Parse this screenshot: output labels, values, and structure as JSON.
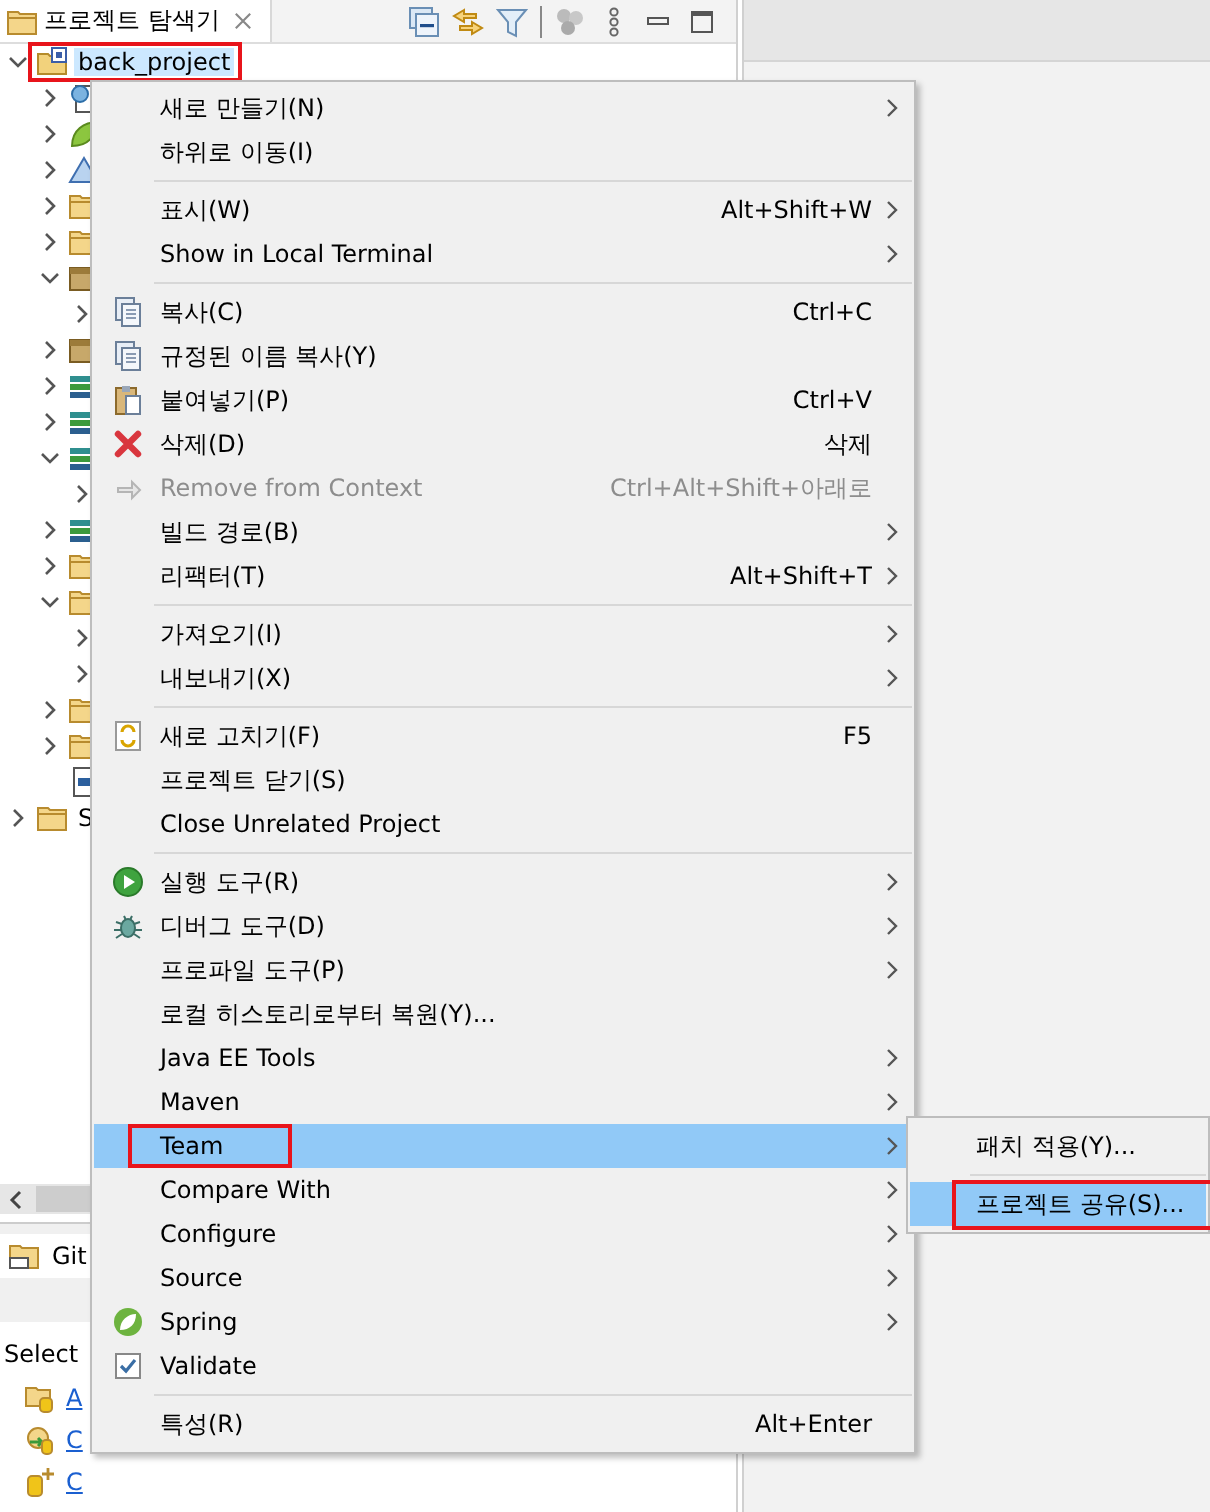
{
  "explorer": {
    "title": "프로젝트 탐색기",
    "tree": [
      {
        "label": "back_project",
        "kind": "project",
        "expanded": true,
        "selected": true,
        "annotated": true,
        "children": [
          {
            "kind": "doc",
            "expanded": false
          },
          {
            "kind": "spring",
            "expanded": false
          },
          {
            "kind": "deploy",
            "expanded": false
          },
          {
            "kind": "folder",
            "expanded": false
          },
          {
            "kind": "folder",
            "expanded": false
          },
          {
            "kind": "package",
            "expanded": true,
            "children": [
              {
                "expanded": false
              }
            ]
          },
          {
            "kind": "package",
            "expanded": false
          },
          {
            "kind": "library",
            "expanded": false
          },
          {
            "kind": "library",
            "expanded": false
          },
          {
            "kind": "library",
            "expanded": true,
            "children": [
              {
                "expanded": false
              }
            ]
          },
          {
            "kind": "library",
            "expanded": false
          },
          {
            "kind": "folder",
            "expanded": false
          },
          {
            "kind": "folder",
            "expanded": true,
            "children": [
              {
                "expanded": false
              },
              {
                "expanded": false
              }
            ]
          },
          {
            "kind": "folder",
            "expanded": false
          },
          {
            "kind": "folder",
            "expanded": false
          },
          {
            "kind": "file"
          }
        ]
      },
      {
        "label": "S",
        "kind": "folder",
        "expanded": false,
        "selected": false
      }
    ]
  },
  "git_panel": {
    "title": "Git",
    "hint": "Select",
    "links": [
      "A",
      "C",
      "C"
    ]
  },
  "context_menu": {
    "groups": [
      [
        {
          "label": "새로 만들기(N)",
          "submenu": true,
          "disabled": false,
          "selected": false
        },
        {
          "label": "하위로 이동(I)",
          "submenu": false,
          "disabled": false,
          "selected": false
        }
      ],
      [
        {
          "label": "표시(W)",
          "shortcut": "Alt+Shift+W",
          "submenu": true,
          "disabled": false,
          "selected": false
        },
        {
          "label": "Show in Local Terminal",
          "submenu": true,
          "disabled": false,
          "selected": false
        }
      ],
      [
        {
          "label": "복사(C)",
          "shortcut": "Ctrl+C",
          "submenu": false,
          "disabled": false,
          "selected": false
        },
        {
          "label": "규정된 이름 복사(Y)",
          "submenu": false,
          "disabled": false,
          "selected": false
        },
        {
          "label": "붙여넣기(P)",
          "shortcut": "Ctrl+V",
          "submenu": false,
          "disabled": false,
          "selected": false
        },
        {
          "label": "삭제(D)",
          "shortcut": "삭제",
          "submenu": false,
          "disabled": false,
          "selected": false
        },
        {
          "label": "Remove from Context",
          "shortcut": "Ctrl+Alt+Shift+아래로",
          "submenu": false,
          "disabled": true,
          "selected": false
        },
        {
          "label": "빌드 경로(B)",
          "submenu": true,
          "disabled": false,
          "selected": false
        },
        {
          "label": "리팩터(T)",
          "shortcut": "Alt+Shift+T",
          "submenu": true,
          "disabled": false,
          "selected": false
        }
      ],
      [
        {
          "label": "가져오기(I)",
          "submenu": true,
          "disabled": false,
          "selected": false
        },
        {
          "label": "내보내기(X)",
          "submenu": true,
          "disabled": false,
          "selected": false
        }
      ],
      [
        {
          "label": "새로 고치기(F)",
          "shortcut": "F5",
          "submenu": false,
          "disabled": false,
          "selected": false
        },
        {
          "label": "프로젝트 닫기(S)",
          "submenu": false,
          "disabled": false,
          "selected": false
        },
        {
          "label": "Close Unrelated Project",
          "submenu": false,
          "disabled": false,
          "selected": false
        }
      ],
      [
        {
          "label": "실행 도구(R)",
          "submenu": true,
          "disabled": false,
          "selected": false
        },
        {
          "label": "디버그 도구(D)",
          "submenu": true,
          "disabled": false,
          "selected": false
        },
        {
          "label": "프로파일 도구(P)",
          "submenu": true,
          "disabled": false,
          "selected": false
        },
        {
          "label": "로컬 히스토리로부터 복원(Y)...",
          "submenu": false,
          "disabled": false,
          "selected": false
        },
        {
          "label": "Java EE Tools",
          "submenu": true,
          "disabled": false,
          "selected": false
        },
        {
          "label": "Maven",
          "submenu": true,
          "disabled": false,
          "selected": false
        },
        {
          "label": "Team",
          "submenu": true,
          "disabled": false,
          "selected": true,
          "annotated": true
        },
        {
          "label": "Compare With",
          "submenu": true,
          "disabled": false,
          "selected": false
        },
        {
          "label": "Configure",
          "submenu": true,
          "disabled": false,
          "selected": false
        },
        {
          "label": "Source",
          "submenu": true,
          "disabled": false,
          "selected": false
        },
        {
          "label": "Spring",
          "submenu": true,
          "disabled": false,
          "selected": false
        },
        {
          "label": "Validate",
          "submenu": false,
          "disabled": false,
          "selected": false
        }
      ],
      [
        {
          "label": "특성(R)",
          "shortcut": "Alt+Enter",
          "submenu": false,
          "disabled": false,
          "selected": false
        }
      ]
    ]
  },
  "team_submenu": {
    "groups": [
      [
        {
          "label": "패치 적용(Y)...",
          "selected": false
        }
      ],
      [
        {
          "label": "프로젝트 공유(S)...",
          "selected": true,
          "annotated": true
        }
      ]
    ]
  }
}
